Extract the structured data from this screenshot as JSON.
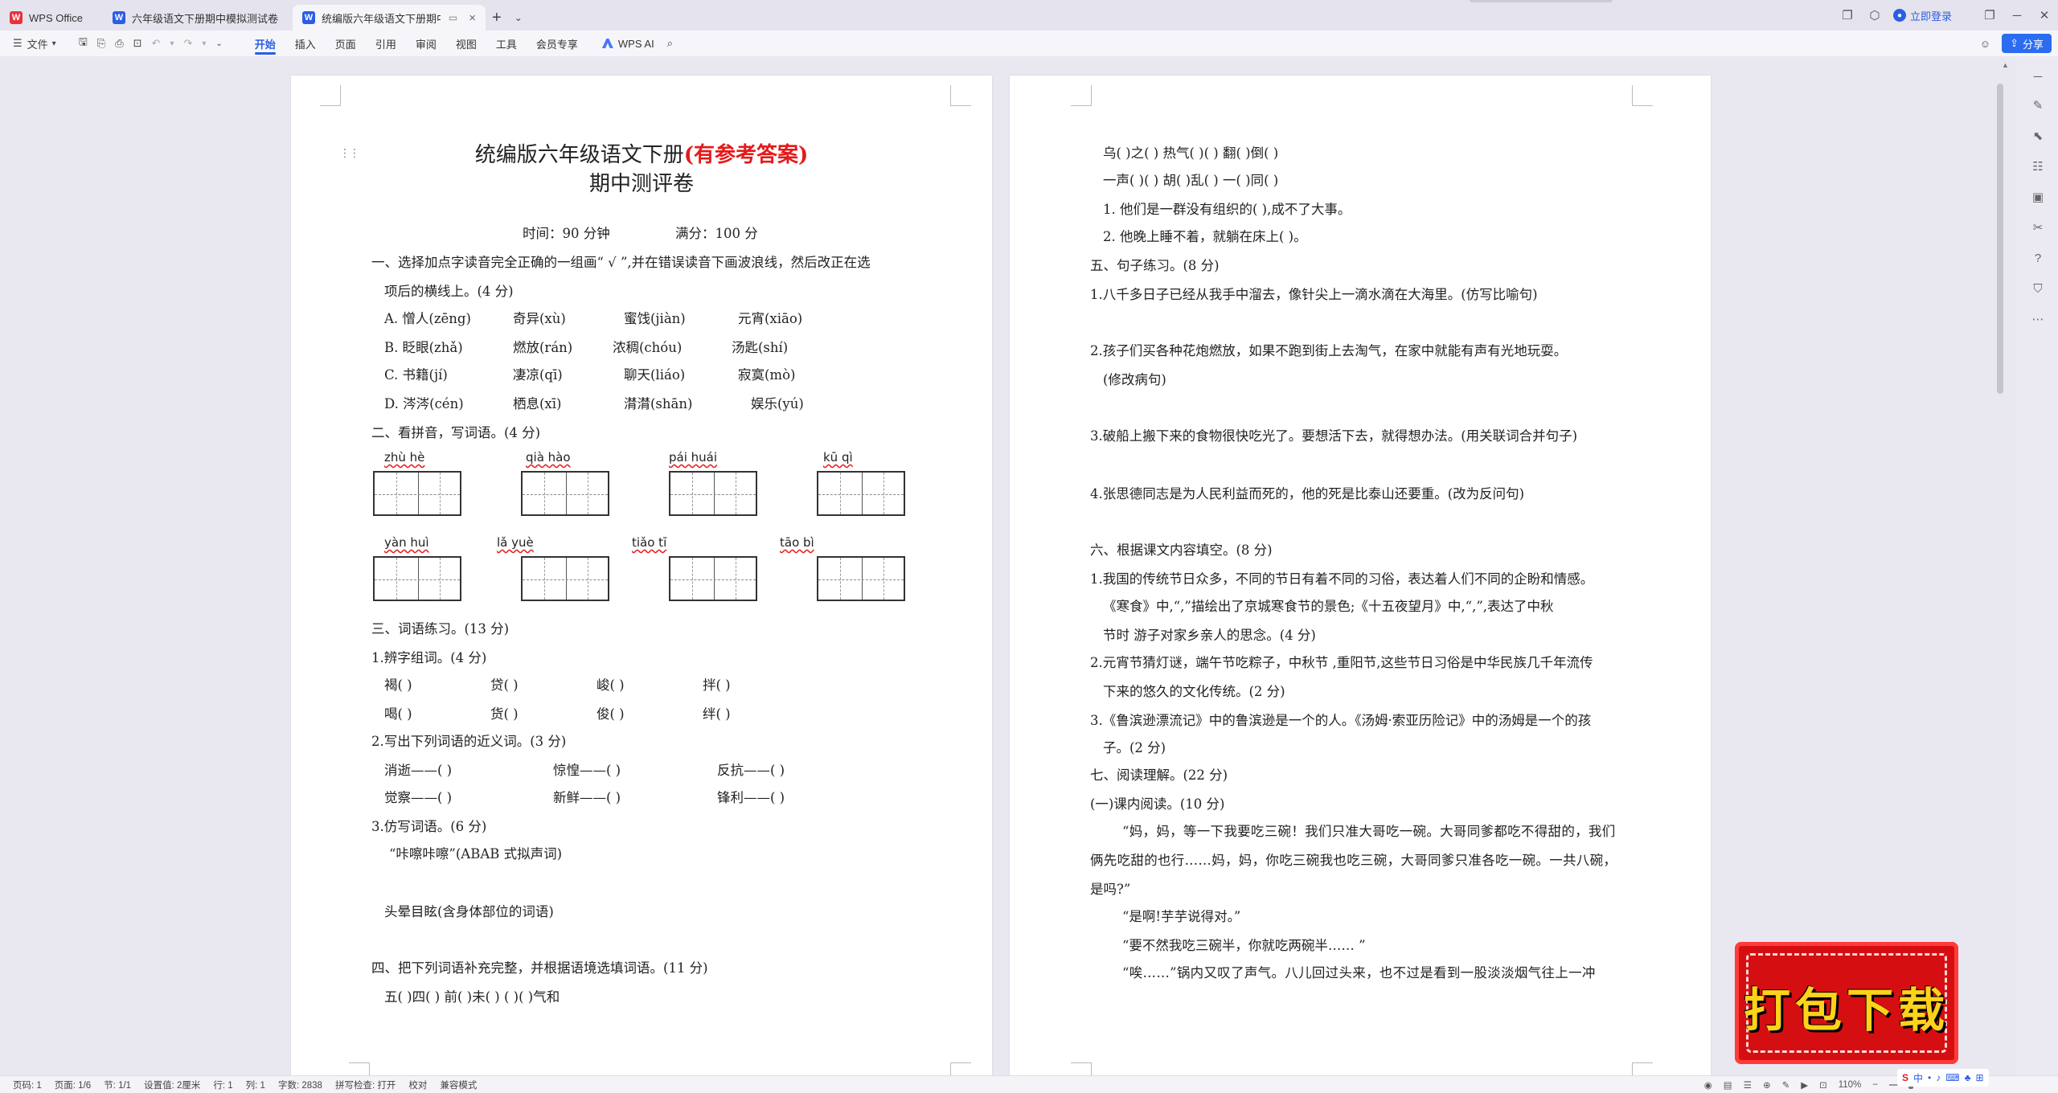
{
  "tabs": [
    {
      "label": "WPS Office",
      "icon": "wps-logo-icon"
    },
    {
      "label": "六年级语文下册期中模拟测试卷（二）",
      "icon": "word-doc-icon"
    },
    {
      "label": "统编版六年级语文下册期中测",
      "icon": "word-doc-icon"
    }
  ],
  "topbar": {
    "login": "立即登录"
  },
  "ribbon": {
    "file": "文件",
    "menus": [
      "开始",
      "插入",
      "页面",
      "引用",
      "审阅",
      "视图",
      "工具",
      "会员专享"
    ],
    "ai": "WPS AI",
    "share": "分享"
  },
  "page1": {
    "title_main": "统编版六年级语文下册",
    "title_red": "(有参考答案)",
    "title_sub": "期中测评卷",
    "time": "时间：90 分钟",
    "score": "满分：100 分",
    "q1": "一、选择加点字读音完全正确的一组画“ √ ”,并在错误读音下画波浪线，然后改正在选",
    "q1b": "项后的横线上。(4 分)",
    "q1_rows": [
      [
        "A. 憎人(zēng)",
        "奇异(xù)",
        "蜜饯(jiàn)",
        "元宵(xiāo)"
      ],
      [
        "B. 眨眼(zhǎ)",
        "燃放(rán)",
        "浓稠(chóu)",
        "汤匙(shí)"
      ],
      [
        "C. 书籍(jí)",
        "凄凉(qī)",
        "聊天(liáo)",
        "寂寞(mò)"
      ],
      [
        "D. 涔涔(cén)",
        "栖息(xī)",
        "潸潸(shān)",
        "娱乐(yú)"
      ]
    ],
    "q2": "二、看拼音，写词语。(4 分)",
    "pinyin": [
      "zhù   hè",
      "qià   hào",
      "pái   huái",
      "kū   qì",
      "yàn   huì",
      "lǎ   yuè",
      "tiǎo   tī",
      "tāo   bì"
    ],
    "q3": "三、词语练习。(13 分)",
    "q3_1": "1.辨字组词。(4 分)",
    "q3_1_rows": [
      [
        "褐(          )",
        "贷(          )",
        "峻(          )",
        "拌(          )"
      ],
      [
        "喝(          )",
        "货(          )",
        "俊(          )",
        "绊(          )"
      ]
    ],
    "q3_2": "2.写出下列词语的近义词。(3 分)",
    "q3_2_rows": [
      [
        "消逝——(          )",
        "惊惶——(          )",
        "反抗——(          )"
      ],
      [
        "觉察——(          )",
        "新鲜——(          )",
        "锋利——(          )"
      ]
    ],
    "q3_3": "3.仿写词语。(6 分)",
    "q3_3a": "“咔嚓咔嚓”(ABAB 式拟声词)",
    "q3_3b": "头晕目眩(含身体部位的词语)",
    "q4": "四、把下列词语补充完整，并根据语境选填词语。(11 分)",
    "q4_row": "五(    )四(        )  前(    )未(    )     (    )(    )气和"
  },
  "page2": {
    "r1": "乌(     )之(     )      热气(     )(     )      翻(     )倒(     )",
    "r2": "一声(     )(     )            胡(     )乱(     )            一(     )同(     )",
    "s1": "1. 他们是一群没有组织的(                ),成不了大事。",
    "s2": "2. 他晚上睡不着，就躺在床上(                )。",
    "q5": "五、句子练习。(8 分)",
    "q5_1": "1.八千多日子已经从我手中溜去，像针尖上一滴水滴在大海里。(仿写比喻句)",
    "q5_2": "2.孩子们买各种花炮燃放，如果不跑到街上去淘气，在家中就能有声有光地玩耍。",
    "q5_2b": "(修改病句)",
    "q5_3": "3.破船上搬下来的食物很快吃光了。要想活下去，就得想办法。(用关联词合并句子)",
    "q5_4": "4.张思德同志是为人民利益而死的，他的死是比泰山还要重。(改为反问句)",
    "q6": "六、根据课文内容填空。(8 分)",
    "q6_1": "1.我国的传统节日众多，不同的节日有着不同的习俗，表达着人们不同的企盼和情感。",
    "q6_1b": "《寒食》中,“,”描绘出了京城寒食节的景色;《十五夜望月》中,“,”,表达了中秋",
    "q6_1c": "节时  游子对家乡亲人的思念。(4 分)",
    "q6_2": "2.元宵节猜灯谜，端午节吃粽子，中秋节  ,重阳节,这些节日习俗是中华民族几千年流传",
    "q6_2b": "下来的悠久的文化传统。(2 分)",
    "q6_3": "3.《鲁滨逊漂流记》中的鲁滨逊是一个的人。《汤姆·索亚历险记》中的汤姆是一个的孩",
    "q6_3b": "子。(2 分)",
    "q7": "七、阅读理解。(22 分)",
    "q7_1": "(一)课内阅读。(10 分)",
    "p1": "“妈，妈，等一下我要吃三碗！我们只准大哥吃一碗。大哥同爹都吃不得甜的，我们",
    "p1b": "俩先吃甜的也行……妈，妈，你吃三碗我也吃三碗，大哥同爹只准各吃一碗。一共八碗，",
    "p1c": "是吗?”",
    "p2": "“是啊!芋芋说得对。”",
    "p3": "“要不然我吃三碗半，你就吃两碗半…… ”",
    "p4": "“唉……”锅内又叹了声气。八儿回过头来，也不过是看到一股淡淡烟气往上一冲"
  },
  "status": [
    "页码: 1",
    "页面: 1/6",
    "节: 1/1",
    "设置值: 2厘米",
    "行: 1",
    "列: 1",
    "字数: 2838",
    "拼写检查: 打开",
    "校对",
    "兼容模式"
  ],
  "zoom": "110%",
  "banner": "打包下载",
  "colors": {
    "accent": "#2b5de6",
    "title_red": "#e41a1a",
    "banner_red": "#d50f11",
    "banner_text": "#ffd21a"
  }
}
